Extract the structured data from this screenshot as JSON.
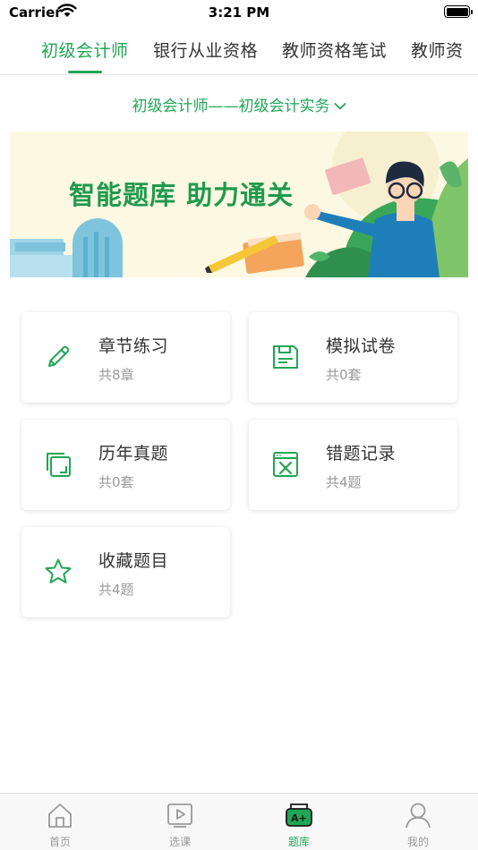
{
  "status_bar": {
    "carrier": "Carrier",
    "time": "3:21 PM"
  },
  "top_tabs": [
    {
      "label": "初级会计师",
      "active": true
    },
    {
      "label": "银行从业资格",
      "active": false
    },
    {
      "label": "教师资格笔试",
      "active": false
    },
    {
      "label": "教师资",
      "active": false
    }
  ],
  "subject_selector": {
    "label": "初级会计师——初级会计实务"
  },
  "banner": {
    "title": "智能题库  助力通关"
  },
  "cards": [
    {
      "title": "章节练习",
      "subtitle": "共8章",
      "icon": "pencil-icon"
    },
    {
      "title": "模拟试卷",
      "subtitle": "共0套",
      "icon": "floppy-disk-icon"
    },
    {
      "title": "历年真题",
      "subtitle": "共0套",
      "icon": "stacked-pages-icon"
    },
    {
      "title": "错题记录",
      "subtitle": "共4题",
      "icon": "wrong-answer-book-icon"
    },
    {
      "title": "收藏题目",
      "subtitle": "共4题",
      "icon": "star-icon"
    }
  ],
  "tab_bar": [
    {
      "label": "首页",
      "icon": "home-icon",
      "active": false
    },
    {
      "label": "选课",
      "icon": "video-play-icon",
      "active": false
    },
    {
      "label": "题库",
      "icon": "question-bank-icon",
      "active": true,
      "badge": "A+"
    },
    {
      "label": "我的",
      "icon": "user-icon",
      "active": false
    }
  ],
  "colors": {
    "accent": "#1fa654",
    "text": "#333333",
    "muted": "#999999"
  }
}
